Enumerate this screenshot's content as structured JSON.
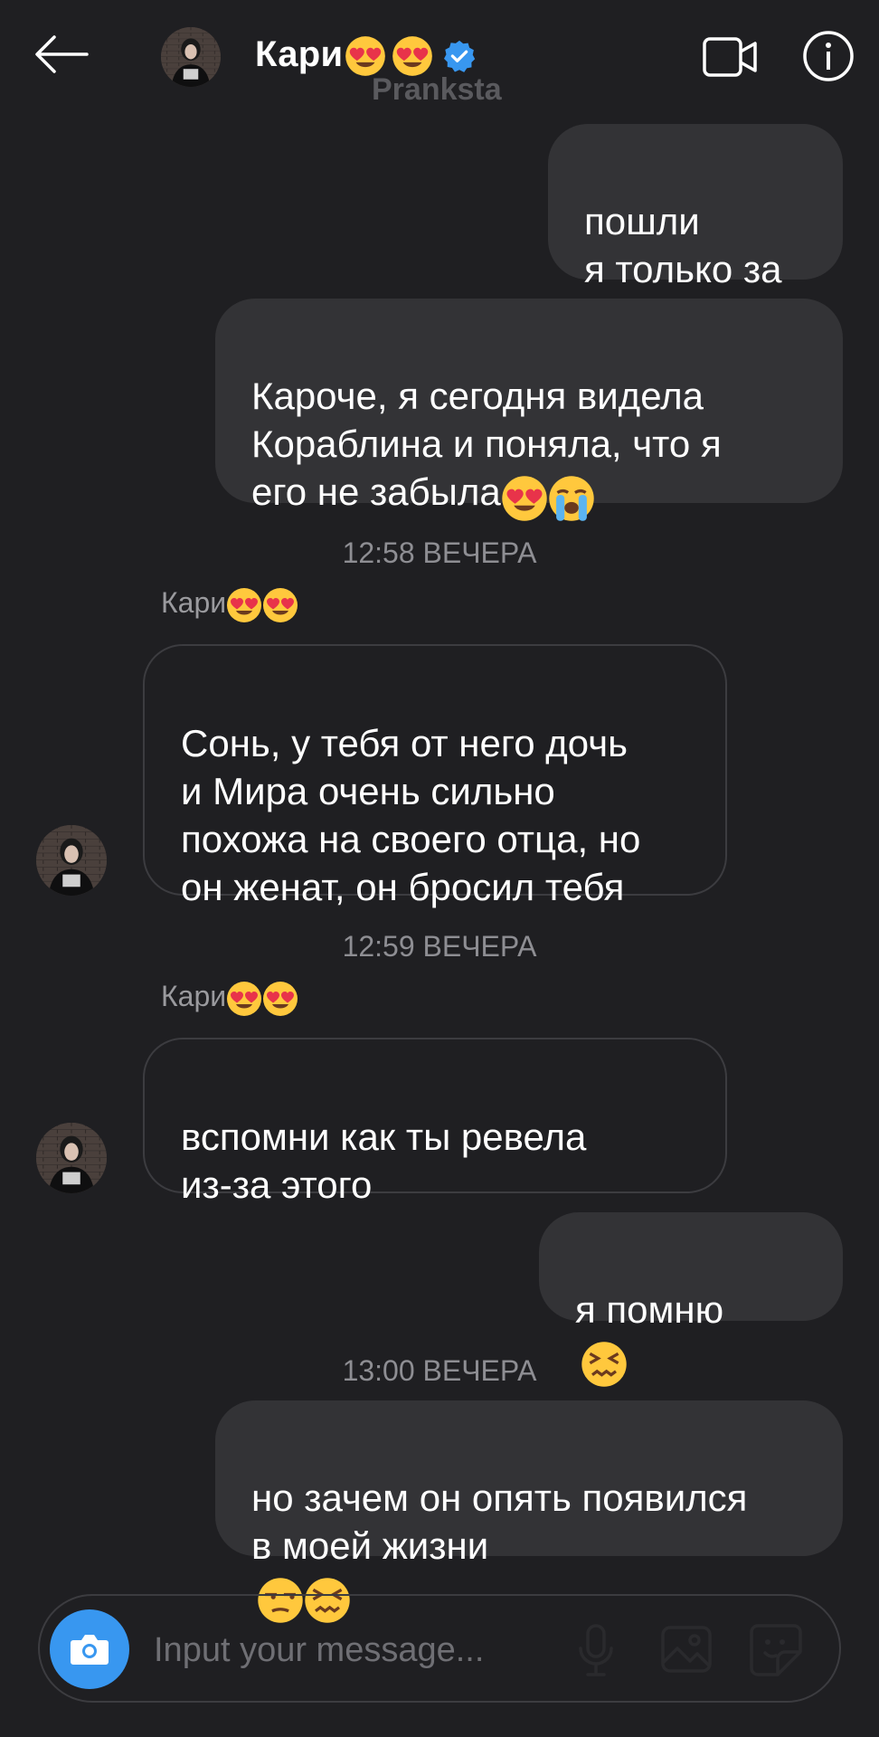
{
  "header": {
    "contact_name": "Кари",
    "name_emojis": [
      "heart-eyes",
      "heart-eyes"
    ],
    "watermark": "Pranksta",
    "icons": [
      "back-arrow-icon",
      "video-call-icon",
      "info-icon",
      "verified-badge-icon"
    ]
  },
  "messages": [
    {
      "side": "out",
      "text": "пошли\nя только за"
    },
    {
      "side": "out",
      "text": "Кароче, я сегодня видела\nКораблина и поняла, что я\nего не забыла",
      "emojis": [
        "heart-eyes",
        "crying"
      ]
    },
    {
      "timestamp": "12:58 ВЕЧЕРА"
    },
    {
      "sender": "Кари",
      "sender_emojis": [
        "heart-eyes",
        "heart-eyes"
      ]
    },
    {
      "side": "in",
      "text": "Сонь, у тебя от него дочь\nи Мира очень сильно\nпохожа на своего отца, но\nон женат, он бросил тебя"
    },
    {
      "timestamp": "12:59 ВЕЧЕРА"
    },
    {
      "sender": "Кари",
      "sender_emojis": [
        "heart-eyes",
        "heart-eyes"
      ]
    },
    {
      "side": "in",
      "text": "вспомни как ты ревела\nиз-за этого"
    },
    {
      "side": "out",
      "text": "я помню",
      "emojis": [
        "confounded"
      ]
    },
    {
      "timestamp": "13:00 ВЕЧЕРА"
    },
    {
      "side": "out",
      "text": "но зачем он опять появился\nв моей жизни",
      "emojis": [
        "unamused",
        "confounded"
      ]
    }
  ],
  "composer": {
    "placeholder": "Input your message...",
    "icons": [
      "camera-icon",
      "microphone-icon",
      "gallery-icon",
      "sticker-icon"
    ]
  },
  "colors": {
    "background": "#1f1f22",
    "bubble_out": "#333336",
    "bubble_in_border": "#3c3c40",
    "accent": "#3897f0"
  }
}
